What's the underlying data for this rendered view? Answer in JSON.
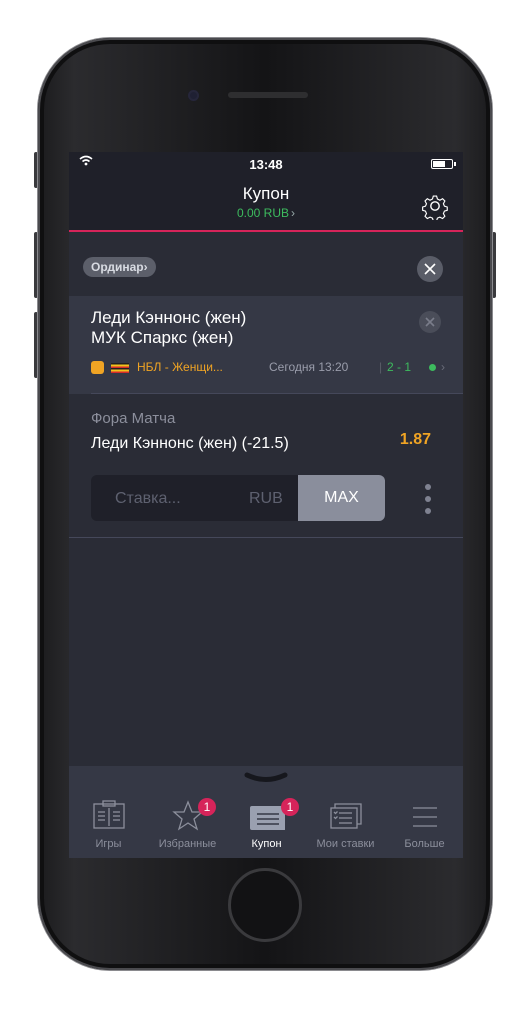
{
  "status_bar": {
    "time": "13:48"
  },
  "nav": {
    "title": "Купон",
    "balance": "0.00 RUB",
    "balance_chevron": "›"
  },
  "coupon": {
    "type_label": "Ординар",
    "type_chevron": "›"
  },
  "event": {
    "team1": "Леди Кэннонс (жен)",
    "team2": "МУК Спаркс (жен)",
    "league": "НБЛ - Женщи...",
    "time": "Сегодня 13:20",
    "separator": "|",
    "score": "2 - 1",
    "chevron": "›"
  },
  "market": {
    "title": "Фора Матча",
    "selection": "Леди Кэннонс (жен)  (-21.5)",
    "odds": "1.87",
    "stake_placeholder": "Ставка...",
    "currency": "RUB",
    "max_label": "MAX"
  },
  "tabs": [
    {
      "label": "Игры",
      "icon": "games-icon",
      "badge": ""
    },
    {
      "label": "Избранные",
      "icon": "star-icon",
      "badge": "1"
    },
    {
      "label": "Купон",
      "icon": "coupon-icon",
      "badge": "1",
      "active": true
    },
    {
      "label": "Мои ставки",
      "icon": "my-bets-icon",
      "badge": ""
    },
    {
      "label": "Больше",
      "icon": "menu-icon",
      "badge": ""
    }
  ],
  "colors": {
    "accent": "#d6245a",
    "positive": "#3dbb5e",
    "odds": "#f0a424",
    "background": "#2a2c36"
  }
}
